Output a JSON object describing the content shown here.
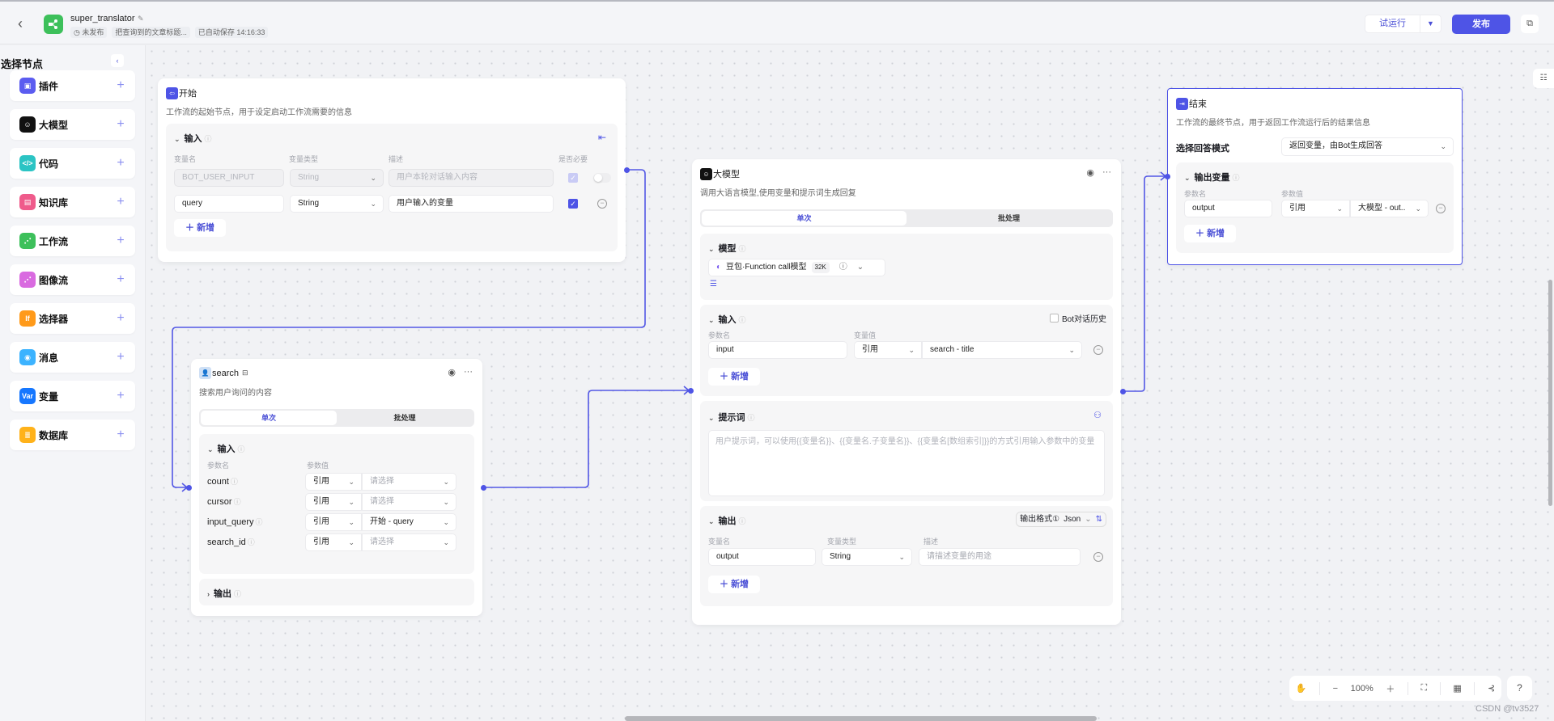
{
  "topbar": {
    "title": "super_translator",
    "status": "未发布",
    "description": "把查询到的文章标题...",
    "autosave": "已自动保存 14:16:33",
    "run_label": "试运行",
    "publish_label": "发布"
  },
  "sidebar": {
    "title": "选择节点",
    "items": [
      {
        "label": "插件",
        "icon": "plugin-icon",
        "color": "#5b5cf0",
        "glyph": "▣"
      },
      {
        "label": "大模型",
        "icon": "llm-icon",
        "color": "#111111",
        "glyph": "☺"
      },
      {
        "label": "代码",
        "icon": "code-icon",
        "color": "#2bc4c4",
        "glyph": "</>"
      },
      {
        "label": "知识库",
        "icon": "knowledge-icon",
        "color": "#ef5b8b",
        "glyph": "▤"
      },
      {
        "label": "工作流",
        "icon": "workflow-icon",
        "color": "#3dc05b",
        "glyph": "⋰"
      },
      {
        "label": "图像流",
        "icon": "imageflow-icon",
        "color": "#d96be0",
        "glyph": "⋰"
      },
      {
        "label": "选择器",
        "icon": "selector-icon",
        "color": "#ff9a1a",
        "glyph": "If"
      },
      {
        "label": "消息",
        "icon": "message-icon",
        "color": "#3cb3ff",
        "glyph": "◉"
      },
      {
        "label": "变量",
        "icon": "variable-icon",
        "color": "#1677ff",
        "glyph": "Var"
      },
      {
        "label": "数据库",
        "icon": "database-icon",
        "color": "#ffb21a",
        "glyph": "≣"
      }
    ]
  },
  "start_node": {
    "title": "开始",
    "description": "工作流的起始节点，用于设定启动工作流需要的信息",
    "section": "输入",
    "columns": [
      "变量名",
      "变量类型",
      "描述",
      "是否必要"
    ],
    "rows": [
      {
        "name": "BOT_USER_INPUT",
        "type": "String",
        "desc": "用户本轮对话输入内容",
        "required": true,
        "disabled": true
      },
      {
        "name": "query",
        "type": "String",
        "desc": "用户输入的变量",
        "required": true,
        "disabled": false
      }
    ],
    "add_label": "新增"
  },
  "search_node": {
    "title": "search",
    "description": "搜索用户询问的内容",
    "tabs": [
      "单次",
      "批处理"
    ],
    "input_section": "输入",
    "columns": [
      "参数名",
      "参数值"
    ],
    "params": [
      {
        "name": "count",
        "mode": "引用",
        "value": "请选择",
        "placeholder": true
      },
      {
        "name": "cursor",
        "mode": "引用",
        "value": "请选择",
        "placeholder": true
      },
      {
        "name": "input_query",
        "mode": "引用",
        "value": "开始 - query",
        "placeholder": false
      },
      {
        "name": "search_id",
        "mode": "引用",
        "value": "请选择",
        "placeholder": true
      }
    ],
    "output_section": "输出"
  },
  "llm_node": {
    "title": "大模型",
    "description": "调用大语言模型,使用变量和提示词生成回复",
    "tabs": [
      "单次",
      "批处理"
    ],
    "model_section": "模型",
    "model_name": "豆包·Function call模型",
    "model_ctx": "32K",
    "input_section": "输入",
    "history_label": "Bot对话历史",
    "input_columns": [
      "参数名",
      "变量值"
    ],
    "input_row": {
      "name": "input",
      "mode": "引用",
      "value": "search - title"
    },
    "add_label": "新增",
    "prompt_section": "提示词",
    "prompt_placeholder": "用户提示词，可以使用{{变量名}}、{{变量名.子变量名}}、{{变量名[数组索引]}}的方式引用输入参数中的变量",
    "output_section": "输出",
    "output_format_label": "输出格式①",
    "output_format_value": "Json",
    "output_columns": [
      "变量名",
      "变量类型",
      "描述"
    ],
    "output_row": {
      "name": "output",
      "type": "String",
      "desc_placeholder": "请描述变量的用途"
    }
  },
  "end_node": {
    "title": "结束",
    "description": "工作流的最终节点，用于返回工作流运行后的结果信息",
    "mode_label": "选择回答模式",
    "mode_value": "返回变量，由Bot生成回答",
    "output_section": "输出变量",
    "columns": [
      "参数名",
      "参数值"
    ],
    "row": {
      "name": "output",
      "mode": "引用",
      "value": "大模型 - out.."
    },
    "add_label": "新增"
  },
  "zoom_bar": {
    "zoom": "100%"
  },
  "watermark": "CSDN @tv3527",
  "colors": {
    "accent": "#4e54e6",
    "edge": "#5257e5"
  }
}
